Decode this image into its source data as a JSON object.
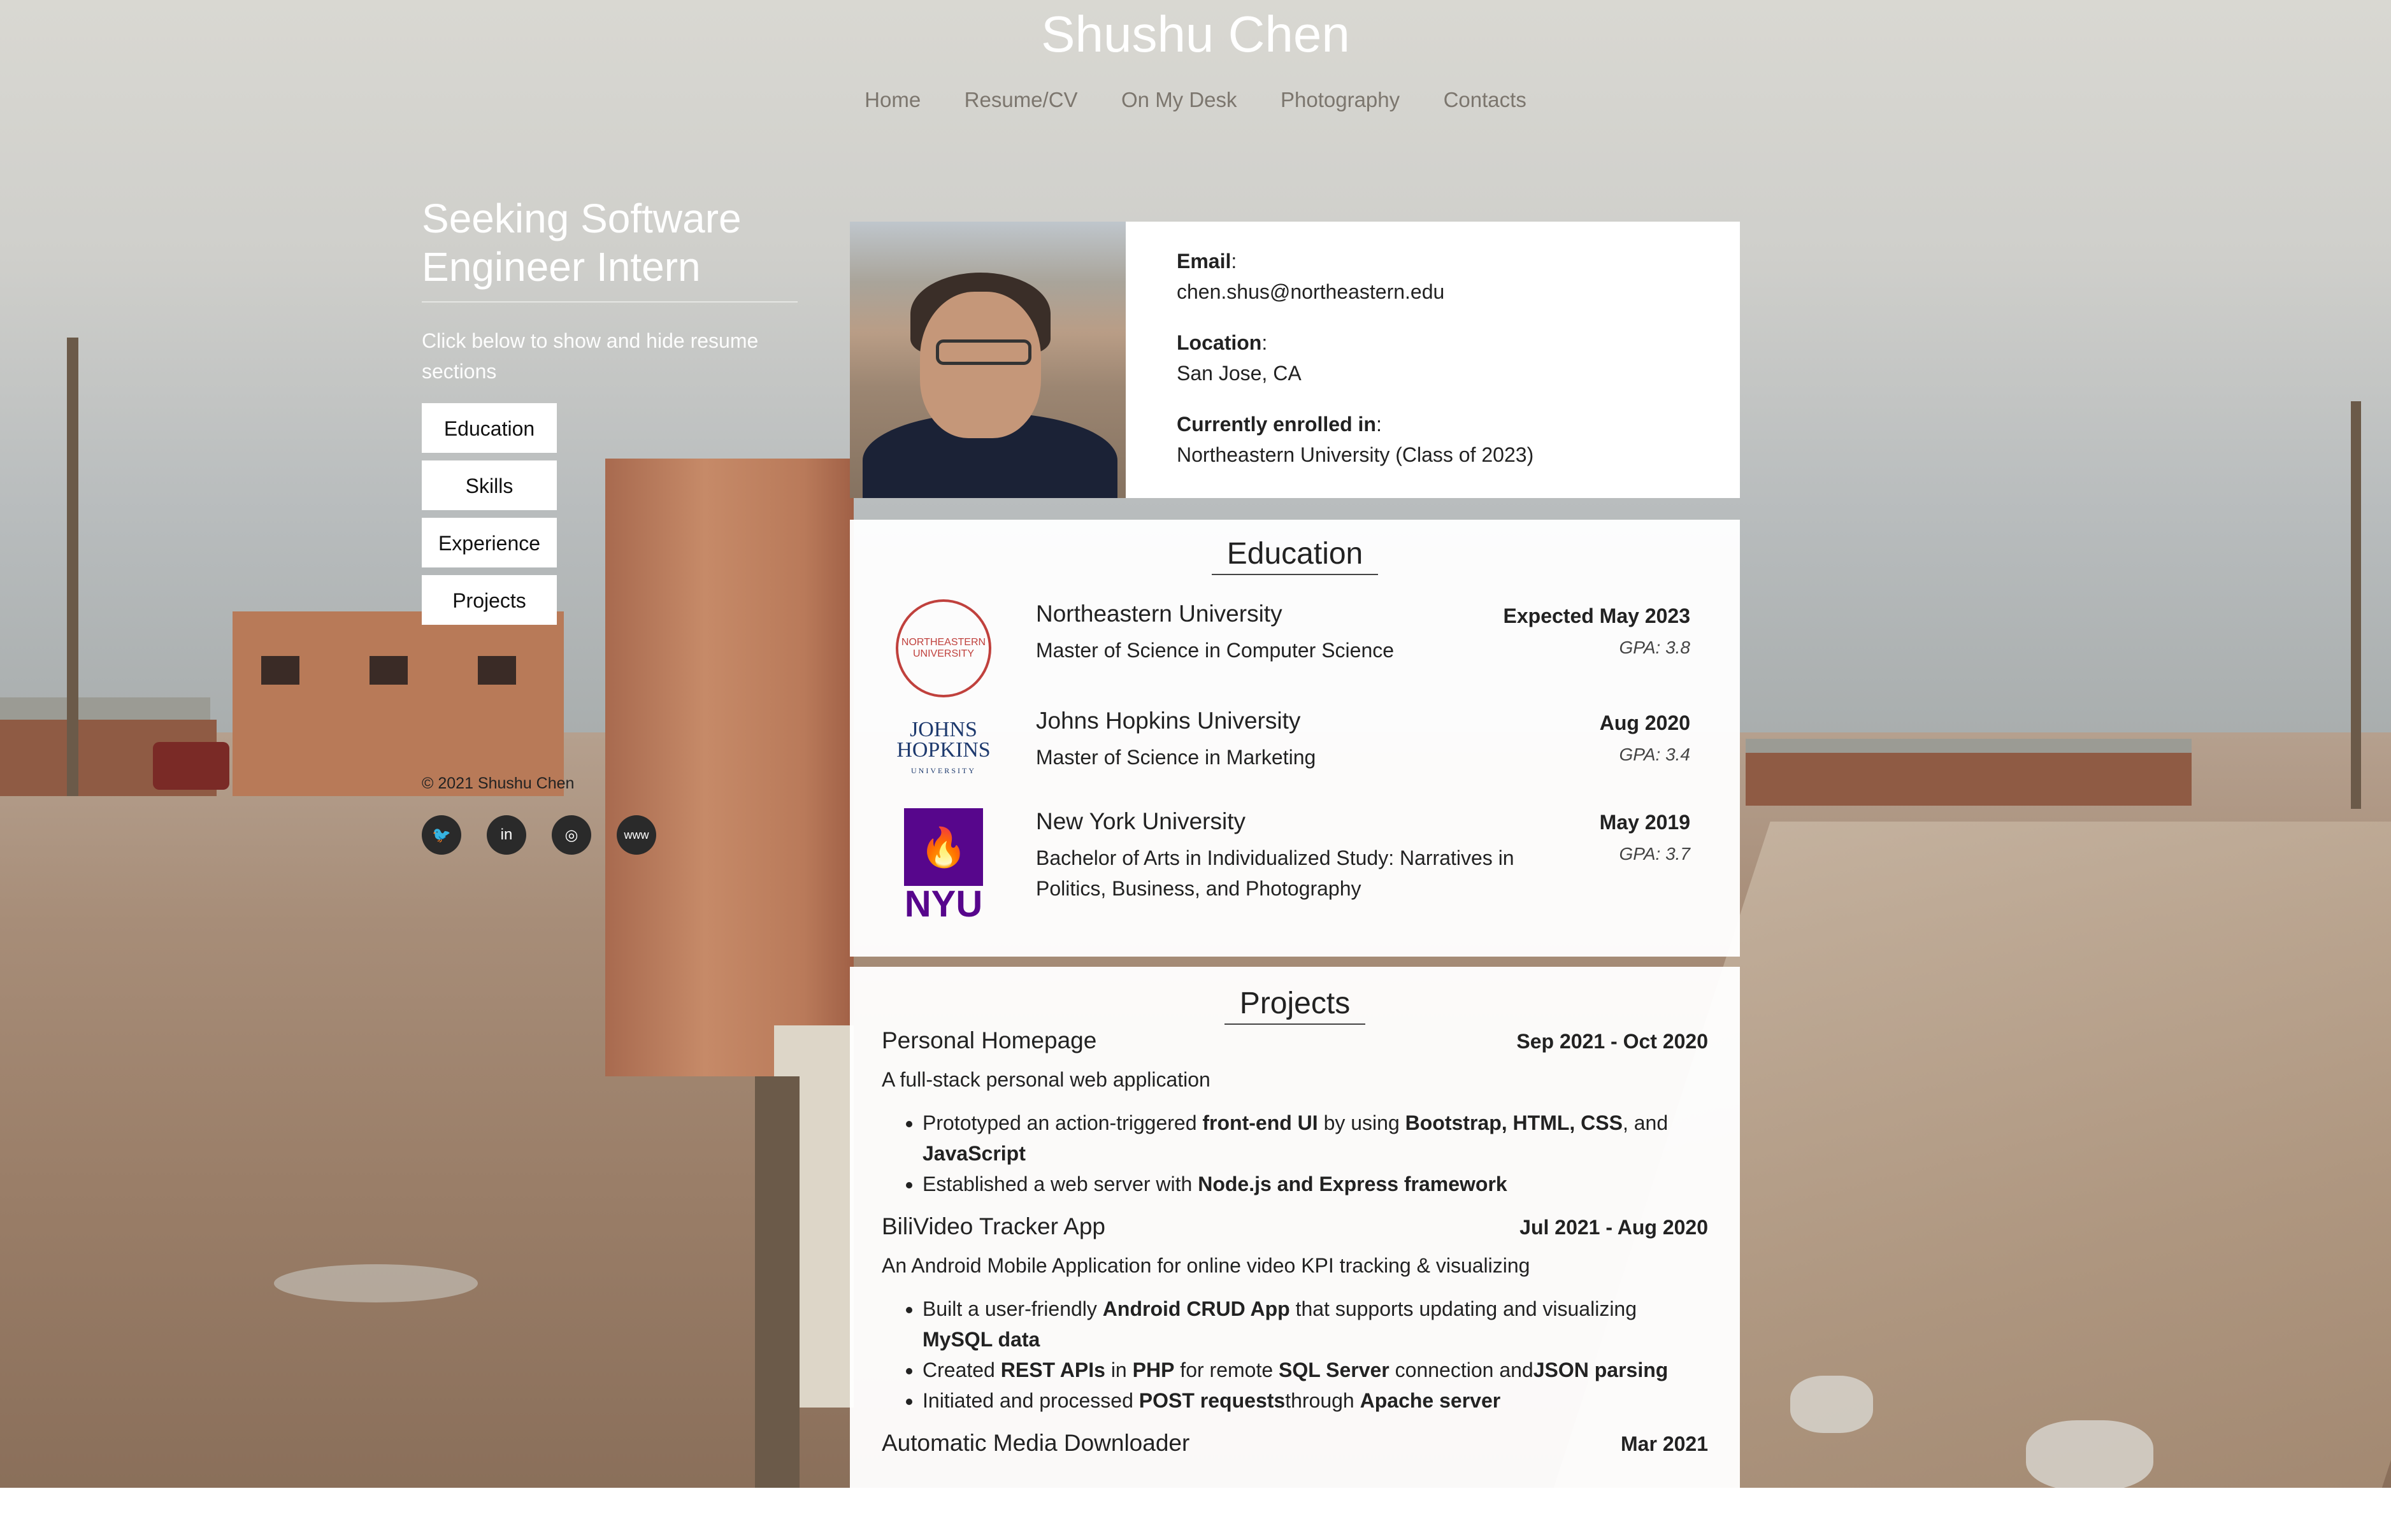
{
  "site": {
    "title": "Shushu Chen"
  },
  "nav": [
    "Home",
    "Resume/CV",
    "On My Desk",
    "Photography",
    "Contacts"
  ],
  "sidebar": {
    "headline": "Seeking Software Engineer Intern",
    "hint": "Click below to show and hide resume sections",
    "buttons": [
      "Education",
      "Skills",
      "Experience",
      "Projects"
    ],
    "copyright": "© 2021 Shushu Chen",
    "social": [
      {
        "icon": "twitter-icon",
        "glyph": "🐦"
      },
      {
        "icon": "linkedin-icon",
        "glyph": "in"
      },
      {
        "icon": "instagram-icon",
        "glyph": "◎"
      },
      {
        "icon": "website-icon",
        "glyph": "www"
      }
    ]
  },
  "profile": {
    "email_label": "Email",
    "email": "chen.shus@northeastern.edu",
    "location_label": "Location",
    "location": "San Jose, CA",
    "enrolled_label": "Currently enrolled in",
    "enrolled": "Northeastern University (Class of 2023)"
  },
  "education": {
    "title": "Education",
    "items": [
      {
        "school": "Northeastern University",
        "degree": "Master of Science in Computer Science",
        "date": "Expected May 2023",
        "gpa": "GPA: 3.8",
        "logo": "NORTHEASTERN UNIVERSITY"
      },
      {
        "school": "Johns Hopkins University",
        "degree": "Master of Science in Marketing",
        "date": "Aug 2020",
        "gpa": "GPA: 3.4",
        "logo_top": "JOHNS",
        "logo_mid": "HOPKINS",
        "logo_bot": "UNIVERSITY"
      },
      {
        "school": "New York University",
        "degree": "Bachelor of Arts in Individualized Study: Narratives in Politics, Business, and Photography",
        "date": "May 2019",
        "gpa": "GPA: 3.7",
        "logo": "NYU"
      }
    ]
  },
  "projects": {
    "title": "Projects",
    "items": [
      {
        "name": "Personal Homepage",
        "date": "Sep 2021 - Oct 2020",
        "desc": "A full-stack personal web application",
        "bullets": [
          [
            "Prototyped an action-triggered ",
            "front-end UI",
            " by using ",
            "Bootstrap, HTML, CSS",
            ", and ",
            "JavaScript",
            ""
          ],
          [
            "Established a web server with ",
            "Node.js and Express framework",
            ""
          ]
        ]
      },
      {
        "name": "BiliVideo Tracker App",
        "date": "Jul 2021 - Aug 2020",
        "desc": "An Android Mobile Application for online video KPI tracking & visualizing",
        "bullets": [
          [
            "Built a user-friendly ",
            "Android CRUD App",
            " that supports updating and visualizing ",
            "MySQL data",
            ""
          ],
          [
            "Created ",
            "REST APIs",
            " in ",
            "PHP",
            " for remote ",
            "SQL Server",
            " connection and",
            "JSON parsing",
            ""
          ],
          [
            "Initiated and processed ",
            "POST requests",
            "through ",
            "Apache server",
            ""
          ]
        ]
      },
      {
        "name": "Automatic Media Downloader",
        "date": "Mar 2021",
        "desc": "",
        "bullets": []
      }
    ]
  }
}
